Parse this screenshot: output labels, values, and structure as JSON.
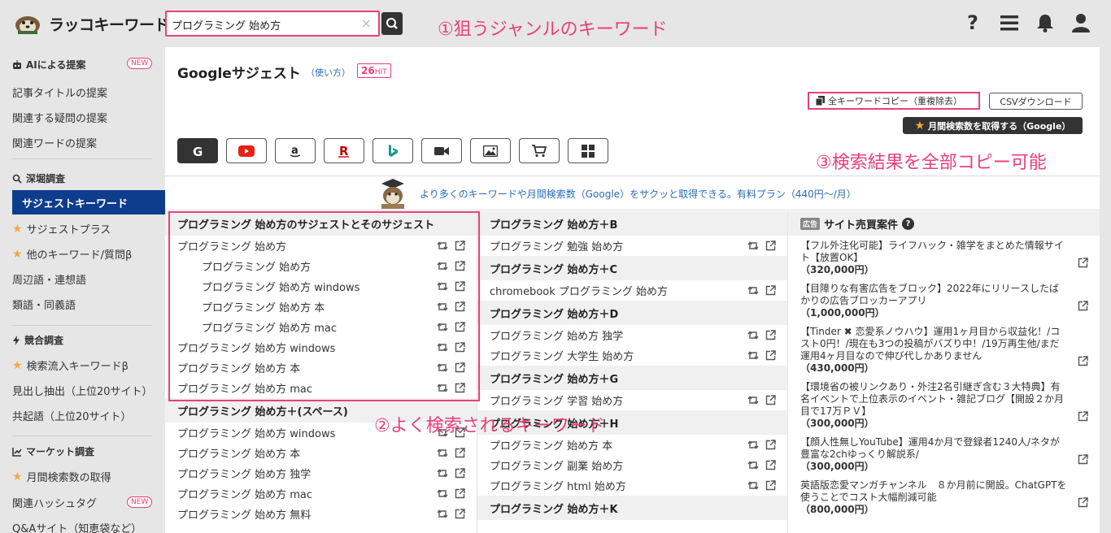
{
  "header": {
    "logo_text": "ラッコキーワード",
    "search_value": "プログラミング 始め方",
    "clear_label": "×",
    "icons": [
      "help-icon",
      "menu-icon",
      "bell-icon",
      "user-icon"
    ]
  },
  "annotations": {
    "a1": "①狙うジャンルのキーワード",
    "a2": "②よく検索されるキーワード",
    "a3": "③検索結果を全部コピー可能"
  },
  "sidebar": {
    "ai_section": "AIによる提案",
    "new_badge": "NEW",
    "ai_items": [
      "記事タイトルの提案",
      "関連する疑問の提案",
      "関連ワードの提案"
    ],
    "deep_section": "深堀調査",
    "active_item": "サジェストキーワード",
    "deep_items": [
      "サジェストプラス",
      "他のキーワード/質問β",
      "周辺語・連想語",
      "類語・同義語"
    ],
    "compete_section": "競合調査",
    "compete_items": [
      "検索流入キーワードβ",
      "見出し抽出（上位20サイト）",
      "共起語（上位20サイト）"
    ],
    "market_section": "マーケット調査",
    "market_items": [
      "月間検索数の取得",
      "関連ハッシュタグ",
      "Q&Aサイト（知恵袋など）"
    ]
  },
  "main": {
    "title": "Googleサジェスト",
    "howto": "（使い方）",
    "hit_count": "26",
    "hit_label": "HIT",
    "copy_all": "全キーワードコピー（重複除去）",
    "csv": "CSVダウンロード",
    "monthly": "月間検索数を取得する（Google）",
    "tabs": [
      "google",
      "youtube",
      "amazon",
      "rakuten",
      "bing",
      "video",
      "image",
      "shopping",
      "app"
    ],
    "promo": "より多くのキーワードや月間検索数（Google）をサクッと取得できる。有料プラン（440円〜/月）"
  },
  "col1": {
    "header": "プログラミング 始め方のサジェストとそのサジェスト",
    "rows": [
      {
        "text": "プログラミング 始め方",
        "indent": false
      },
      {
        "text": "プログラミング 始め方",
        "indent": true
      },
      {
        "text": "プログラミング 始め方 windows",
        "indent": true
      },
      {
        "text": "プログラミング 始め方 本",
        "indent": true
      },
      {
        "text": "プログラミング 始め方 mac",
        "indent": true
      },
      {
        "text": "プログラミング 始め方 windows",
        "indent": false
      },
      {
        "text": "プログラミング 始め方 本",
        "indent": false
      },
      {
        "text": "プログラミング 始め方 mac",
        "indent": false
      }
    ],
    "header2": "プログラミング 始め方＋(スペース)",
    "rows2": [
      "プログラミング 始め方 windows",
      "プログラミング 始め方 本",
      "プログラミング 始め方 独学",
      "プログラミング 始め方 mac",
      "プログラミング 始め方 無料"
    ]
  },
  "col2": {
    "groups": [
      {
        "header": "プログラミング 始め方＋B",
        "rows": [
          "プログラミング 勉強 始め方"
        ]
      },
      {
        "header": "プログラミング 始め方＋C",
        "rows": [
          "chromebook プログラミング 始め方"
        ]
      },
      {
        "header": "プログラミング 始め方＋D",
        "rows": [
          "プログラミング 始め方 独学",
          "プログラミング 大学生 始め方"
        ]
      },
      {
        "header": "プログラミング 始め方＋G",
        "rows": [
          "プログラミング 学習 始め方"
        ]
      },
      {
        "header": "プログラミング 始め方＋H",
        "rows": [
          "プログラミング 始め方 本",
          "プログラミング 副業 始め方",
          "プログラミング html 始め方"
        ]
      },
      {
        "header": "プログラミング 始め方＋K",
        "rows": []
      }
    ]
  },
  "col3": {
    "ad_badge": "広告",
    "header": "サイト売買案件",
    "help": "?",
    "ads": [
      {
        "text": "【フル外注化可能】ライフハック・雑学をまとめた情報サイト【放置OK】",
        "price": "（320,000円）"
      },
      {
        "text": "【目障りな有害広告をブロック】2022年にリリースしたばかりの広告ブロッカーアプリ",
        "price": "（1,000,000円）"
      },
      {
        "text": "【Tinder ✖ 恋愛系ノウハウ】運用1ヶ月目から収益化！/コスト0円！/現在も3つの投稿がバズり中！/19万再生他/まだ運用4ヶ月目なので伸び代しかありません",
        "price": "（430,000円）"
      },
      {
        "text": "【環境省の被リンクあり・外注2名引継ぎ含む３大特典】有名イベントで上位表示のイベント・雑記ブログ【開設２か月目で17万ＰＶ】",
        "price": "（300,000円）"
      },
      {
        "text": "【顔人性無しYouTube】運用4か月で登録者1240人/ネタが豊富な2chゆっくり解説系/",
        "price": "（300,000円）"
      },
      {
        "text": "英語版恋愛マンガチャンネル　８か月前に開設。ChatGPTを使うことでコスト大幅削減可能",
        "price": "（800,000円）"
      }
    ]
  }
}
